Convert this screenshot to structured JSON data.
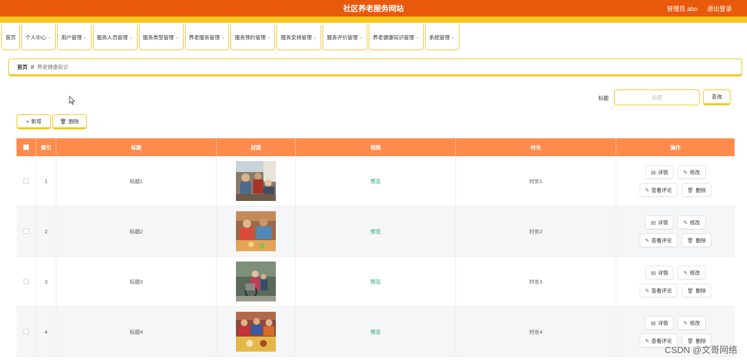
{
  "header": {
    "title": "社区养老服务网站",
    "user_label": "管理员 abo",
    "logout_label": "退出登录"
  },
  "nav": [
    {
      "label": "首页",
      "dropdown": false
    },
    {
      "label": "个人中心",
      "dropdown": true
    },
    {
      "label": "用户管理",
      "dropdown": true
    },
    {
      "label": "服务人员管理",
      "dropdown": true
    },
    {
      "label": "服务类型管理",
      "dropdown": true
    },
    {
      "label": "养老服务管理",
      "dropdown": true
    },
    {
      "label": "服务预约管理",
      "dropdown": true
    },
    {
      "label": "服务安排管理",
      "dropdown": true
    },
    {
      "label": "服务评价管理",
      "dropdown": true
    },
    {
      "label": "养老健康知识管理",
      "dropdown": true
    },
    {
      "label": "系统管理",
      "dropdown": true
    }
  ],
  "breadcrumb": {
    "home": "首页",
    "separator": "//",
    "current": "养老健康知识"
  },
  "search": {
    "label": "标题",
    "placeholder": "标题",
    "button_label": "查询"
  },
  "actions": {
    "add_label": "新增",
    "delete_label": "删除"
  },
  "table": {
    "columns": [
      "索引",
      "标题",
      "封面",
      "视频",
      "时长",
      "操作"
    ],
    "rows": [
      {
        "index": "1",
        "title": "标题1",
        "video": "预览",
        "duration": "时长1"
      },
      {
        "index": "2",
        "title": "标题2",
        "video": "预览",
        "duration": "时长2"
      },
      {
        "index": "3",
        "title": "标题3",
        "video": "预览",
        "duration": "时长3"
      },
      {
        "index": "4",
        "title": "标题4",
        "video": "预览",
        "duration": "时长4"
      }
    ],
    "row_actions": {
      "detail": "详情",
      "edit": "修改",
      "comments": "查看评论",
      "delete": "删除"
    }
  },
  "watermark": "CSDN @文哥网络",
  "colors": {
    "header": "#e8590c",
    "accent": "#f6c71d",
    "table_header": "#fe8b4c",
    "video_link": "#1aa46a"
  }
}
